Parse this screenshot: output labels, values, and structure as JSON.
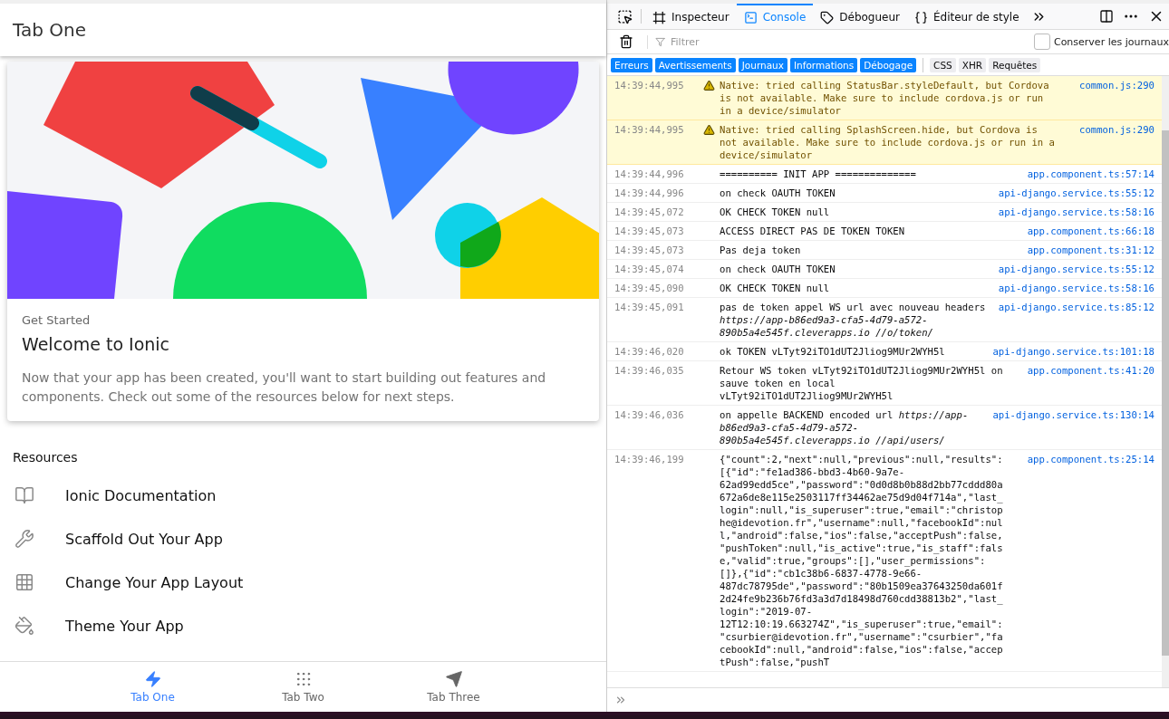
{
  "app": {
    "title": "Tab One",
    "card": {
      "subtitle": "Get Started",
      "title": "Welcome to Ionic",
      "text": "Now that your app has been created, you'll want to start building out features and components. Check out some of the resources below for next steps."
    },
    "resources": {
      "heading": "Resources",
      "items": [
        {
          "kind": "book",
          "label": "Ionic Documentation"
        },
        {
          "kind": "wrench",
          "label": "Scaffold Out Your App"
        },
        {
          "kind": "grid",
          "label": "Change Your App Layout"
        },
        {
          "kind": "paint",
          "label": "Theme Your App"
        }
      ]
    },
    "tabs": [
      {
        "kind": "flash",
        "label": "Tab One",
        "selected": true
      },
      {
        "kind": "apps",
        "label": "Tab Two",
        "selected": false
      },
      {
        "kind": "send",
        "label": "Tab Three",
        "selected": false
      }
    ]
  },
  "devtools": {
    "tabs": [
      {
        "kind": "inspector",
        "label": "Inspecteur",
        "selected": false
      },
      {
        "kind": "console",
        "label": "Console",
        "selected": true
      },
      {
        "kind": "debugger",
        "label": "Débogueur",
        "selected": false
      },
      {
        "kind": "style",
        "label": "Éditeur de style",
        "selected": false
      }
    ],
    "filter": {
      "placeholder": "Filtrer"
    },
    "persist": {
      "label": "Conserver les journaux",
      "checked": false
    },
    "filters": [
      {
        "label": "Erreurs",
        "selected": true
      },
      {
        "label": "Avertissements",
        "selected": true
      },
      {
        "label": "Journaux",
        "selected": true
      },
      {
        "label": "Informations",
        "selected": true
      },
      {
        "label": "Débogage",
        "selected": true
      },
      {
        "label": "CSS",
        "selected": false
      },
      {
        "label": "XHR",
        "selected": false
      },
      {
        "label": "Requêtes",
        "selected": false
      }
    ],
    "messages": [
      {
        "kind": "warning",
        "time": "14:39:44,995",
        "text": "Native: tried calling StatusBar.styleDefault, but Cordova is not available. Make sure to include cordova.js or run in a device/simulator",
        "source": "common.js:290"
      },
      {
        "kind": "warning",
        "time": "14:39:44,995",
        "text": "Native: tried calling SplashScreen.hide, but Cordova is not available. Make sure to include cordova.js or run in a device/simulator",
        "source": "common.js:290"
      },
      {
        "kind": "log",
        "time": "14:39:44,996",
        "text": "========== INIT APP ==============",
        "source": "app.component.ts:57:14"
      },
      {
        "kind": "log",
        "time": "14:39:44,996",
        "text": "on check OAUTH TOKEN",
        "source": "api-django.service.ts:55:12"
      },
      {
        "kind": "log",
        "time": "14:39:45,072",
        "text": "OK CHECK TOKEN null",
        "source": "api-django.service.ts:58:16"
      },
      {
        "kind": "log",
        "time": "14:39:45,073",
        "text": "ACCESS DIRECT PAS DE TOKEN TOKEN",
        "source": "app.component.ts:66:18"
      },
      {
        "kind": "log",
        "time": "14:39:45,073",
        "text": "Pas deja token",
        "source": "app.component.ts:31:12"
      },
      {
        "kind": "log",
        "time": "14:39:45,074",
        "text": "on check OAUTH TOKEN",
        "source": "api-django.service.ts:55:12"
      },
      {
        "kind": "log",
        "time": "14:39:45,090",
        "text": "OK CHECK TOKEN null",
        "source": "api-django.service.ts:58:16"
      },
      {
        "kind": "log",
        "time": "14:39:45,091",
        "text": "pas de token appel WS url avec nouveau headers *https://app-b86ed9a3-cfa5-4d79-a572-890b5a4e545f.cleverapps.io //o/token/*",
        "source": "api-django.service.ts:85:12"
      },
      {
        "kind": "log",
        "time": "14:39:46,020",
        "text": "ok TOKEN vLTyt92iTO1dUT2Jliog9MUr2WYH5l",
        "source": "api-django.service.ts:101:18"
      },
      {
        "kind": "log",
        "time": "14:39:46,035",
        "text": "Retour WS token vLTyt92iTO1dUT2Jliog9MUr2WYH5l on sauve token en local vLTyt92iTO1dUT2Jliog9MUr2WYH5l",
        "source": "app.component.ts:41:20"
      },
      {
        "kind": "log",
        "time": "14:39:46,036",
        "text": "on appelle BACKEND encoded url *https://app-b86ed9a3-cfa5-4d79-a572-890b5a4e545f.cleverapps.io //api/users/*",
        "source": "api-django.service.ts:130:14"
      },
      {
        "kind": "log",
        "time": "14:39:46,199",
        "text": "{\"count\":2,\"next\":null,\"previous\":null,\"results\":[{\"id\":\"fe1ad386-bbd3-4b60-9a7e-62ad99edd5ce\",\"password\":\"0d0d8b0b88d2bb77cddd80a672a6de8e115e2503117ff34462ae75d9d04f714a\",\"last_login\":null,\"is_superuser\":true,\"email\":\"christophe@idevotion.fr\",\"username\":null,\"facebookId\":null,\"android\":false,\"ios\":false,\"acceptPush\":false,\"pushToken\":null,\"is_active\":true,\"is_staff\":false,\"valid\":true,\"groups\":[],\"user_permissions\":[]},{\"id\":\"cb1c38b6-6837-4778-9e66-487dc78795de\",\"password\":\"80b1509ea37643250da601f2d24fe9b236b76fd3a3d7d18498d760cdd38813b2\",\"last_login\":\"2019-07-12T12:10:19.663274Z\",\"is_superuser\":true,\"email\":\"csurbier@idevotion.fr\",\"username\":\"csurbier\",\"facebookId\":null,\"android\":false,\"ios\":false,\"acceptPush\":false,\"pushT",
        "source": "app.component.ts:25:14"
      }
    ]
  }
}
